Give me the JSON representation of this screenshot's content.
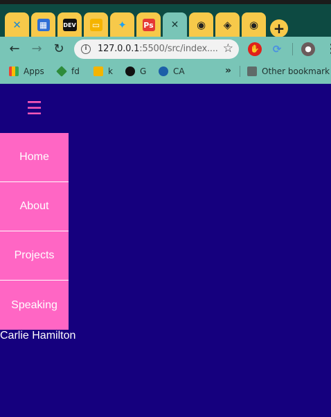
{
  "browser": {
    "tabs": [
      {
        "icon": "vscode-icon",
        "glyph": "✕",
        "color": "#1f8ad2"
      },
      {
        "icon": "calculator-icon",
        "glyph": "▦",
        "color": "#2f6fd6"
      },
      {
        "icon": "dev-icon",
        "glyph": "DEV",
        "color": "#111111"
      },
      {
        "icon": "slides-icon",
        "glyph": "▭",
        "color": "#f5b400"
      },
      {
        "icon": "twitter-icon",
        "glyph": "🐦",
        "color": "#1da1f2"
      },
      {
        "icon": "photopea-icon",
        "glyph": "Ps",
        "color": "#e53935"
      },
      {
        "icon": "active-tab-icon",
        "glyph": "",
        "color": "#79c5b7"
      },
      {
        "icon": "globe-icon",
        "glyph": "◉",
        "color": "#222222"
      },
      {
        "icon": "codepen-icon",
        "glyph": "◈",
        "color": "#222222"
      },
      {
        "icon": "globe-icon",
        "glyph": "◉",
        "color": "#222222"
      }
    ],
    "new_tab_label": "+",
    "address_host": "127.0.0.1",
    "address_rest": ":5500/src/index....",
    "bookmarks": [
      {
        "label": "Apps"
      },
      {
        "label": "fd"
      },
      {
        "label": "k"
      },
      {
        "label": "G"
      },
      {
        "label": "CA"
      }
    ],
    "overflow_label": "»",
    "other_bookmarks": "Other bookmark"
  },
  "page": {
    "menu_icon": "☰",
    "nav": [
      "Home",
      "About",
      "Projects",
      "Speaking"
    ],
    "author": "Carlie Hamilton"
  },
  "colors": {
    "background": "#15007e",
    "accent": "#ff66c4",
    "chrome": "#79c5b7",
    "tab": "#f7c94a"
  }
}
